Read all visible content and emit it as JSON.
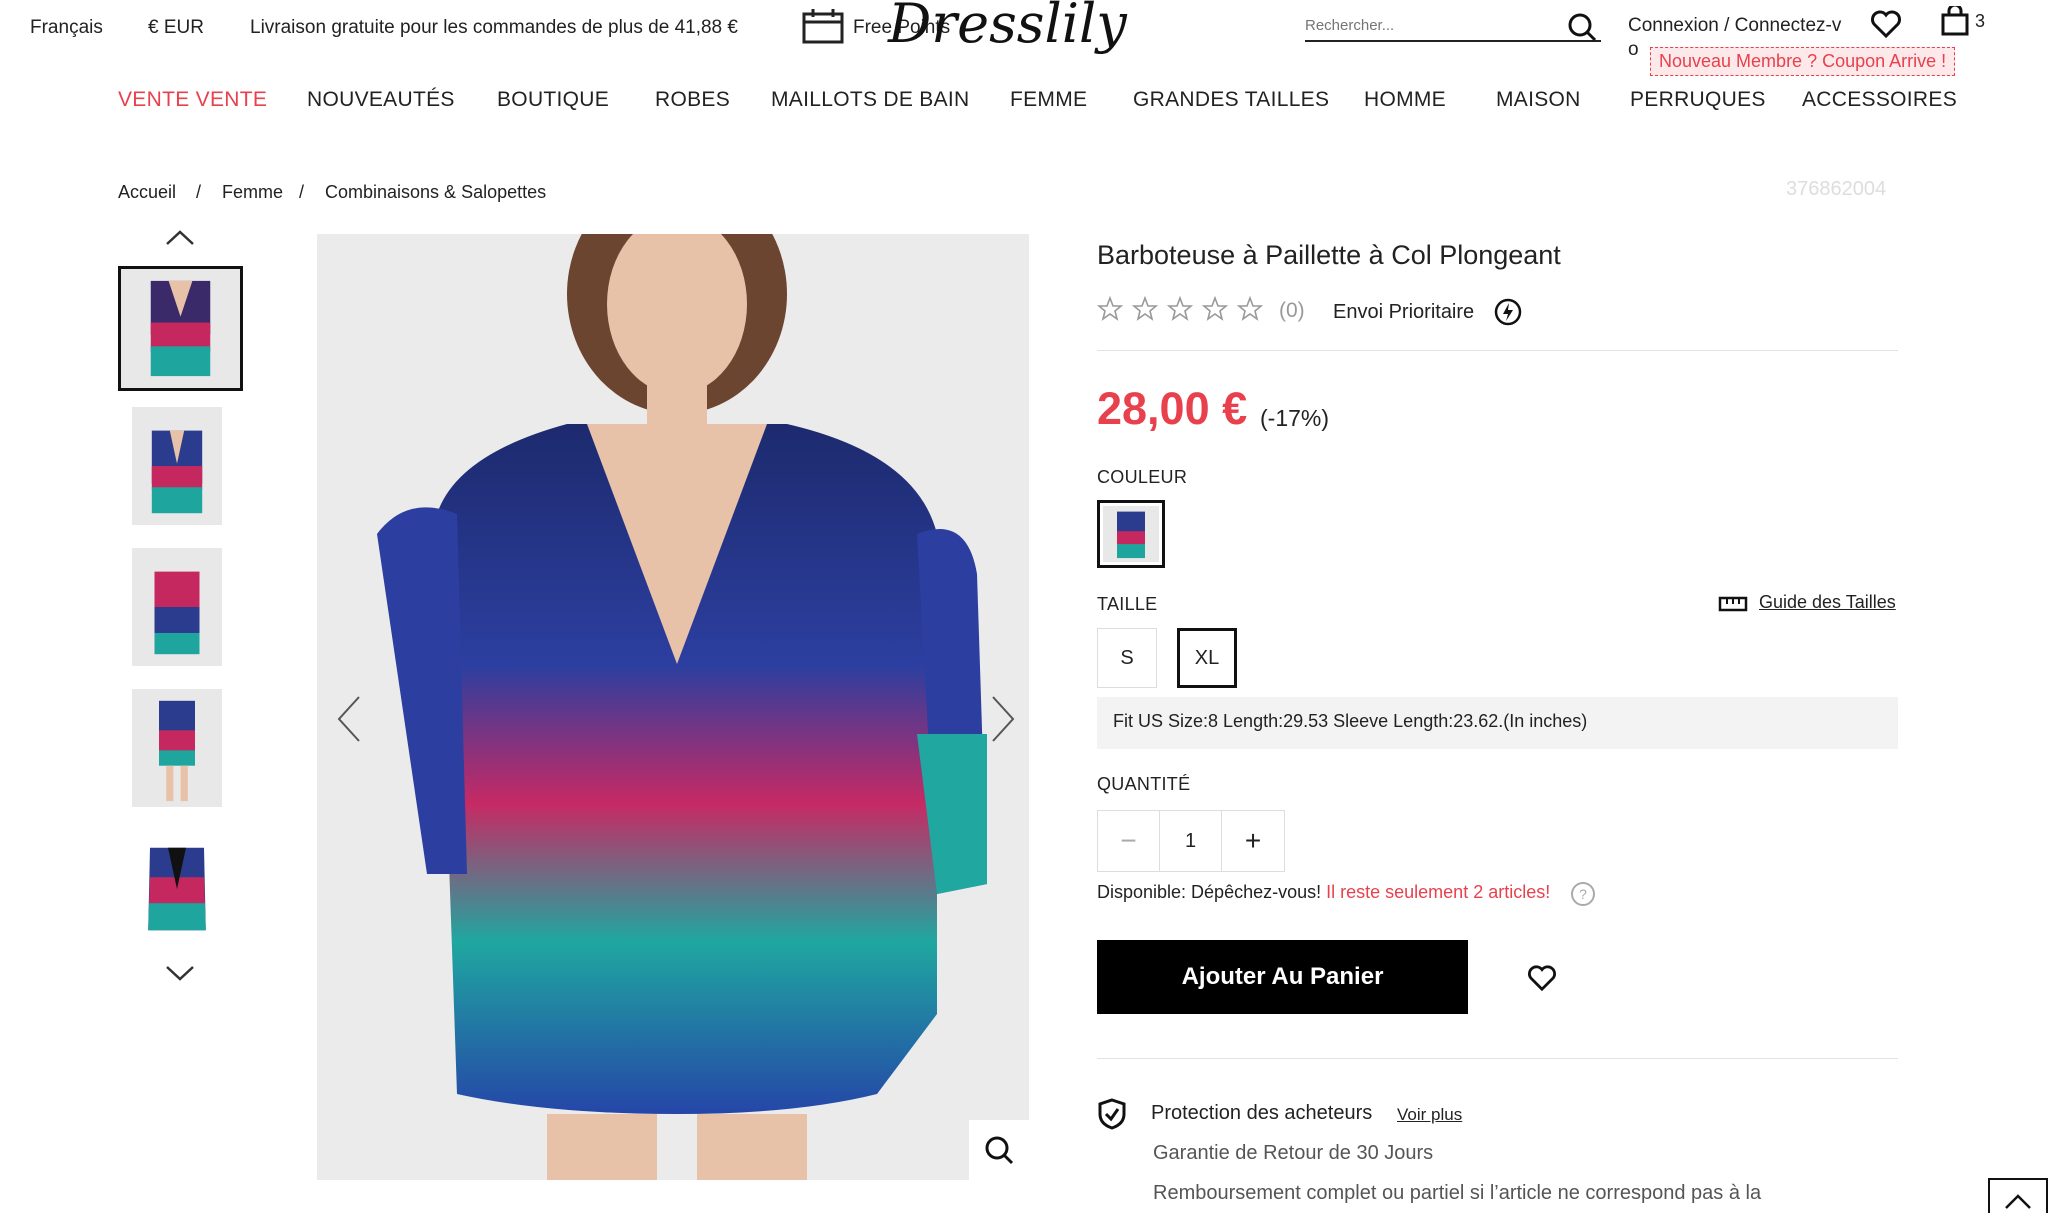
{
  "topbar": {
    "language": "Français",
    "currency": "€ EUR",
    "shipping": "Livraison gratuite pour les commandes de plus de 41,88 €",
    "free_points": "Free Points",
    "logo": "Dresslily",
    "search_placeholder": "Rechercher...",
    "login": "Connexion / Connectez-vo",
    "coupon": "Nouveau Membre ? Coupon Arrive !",
    "cart_count": "3"
  },
  "nav": [
    "VENTE VENTE",
    "NOUVEAUTÉS",
    "BOUTIQUE",
    "ROBES",
    "MAILLOTS DE BAIN",
    "FEMME",
    "GRANDES TAILLES",
    "HOMME",
    "MAISON",
    "PERRUQUES",
    "ACCESSOIRES"
  ],
  "breadcrumb": [
    "Accueil",
    "Femme",
    "Combinaisons & Salopettes"
  ],
  "breadcrumb_sep": "/",
  "sku": "376862004",
  "product": {
    "title": "Barboteuse à Paillette à Col Plongeant",
    "rating_count": "(0)",
    "priority": "Envoi Prioritaire",
    "price": "28,00 €",
    "discount": "(-17%)",
    "color_label": "COULEUR",
    "size_label": "TAILLE",
    "size_guide": "Guide des Tailles",
    "sizes": [
      "S",
      "XL"
    ],
    "selected_size": "XL",
    "size_info": "Fit US Size:8   Length:29.53   Sleeve Length:23.62.(In inches)",
    "qty_label": "QUANTITÉ",
    "qty_value": "1",
    "availability_prefix": "Disponible: Dépêchez-vous! ",
    "availability_alert": "Il reste seulement 2 articles!",
    "add_to_cart": "Ajouter Au Panier",
    "protection_title": "Protection des acheteurs",
    "protection_link": "Voir plus",
    "guarantee1": "Garantie de Retour de 30 Jours",
    "guarantee2": "Remboursement complet ou partiel si l’article ne correspond pas à la"
  },
  "colors": {
    "accent": "#e8414d",
    "dark": "#000000"
  }
}
